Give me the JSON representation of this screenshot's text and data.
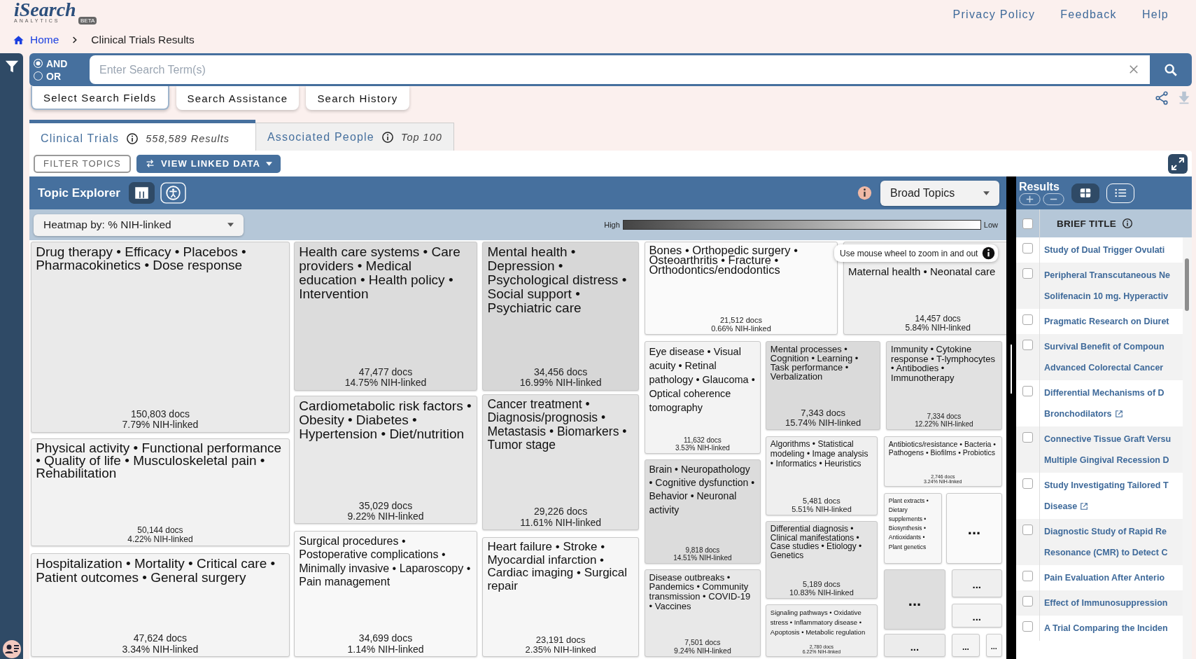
{
  "logo": {
    "name": "iSearch",
    "sub": "ANALYTICS",
    "badge": "BETA"
  },
  "top_links": [
    "Privacy Policy",
    "Feedback",
    "Help"
  ],
  "breadcrumb": {
    "home": "Home",
    "current": "Clinical Trials Results"
  },
  "search": {
    "logic": [
      {
        "label": "AND",
        "selected": true
      },
      {
        "label": "OR",
        "selected": false
      }
    ],
    "placeholder": "Enter Search Term(s)"
  },
  "search_buttons": [
    "Select Search Fields",
    "Search Assistance",
    "Search History"
  ],
  "tabs": [
    {
      "label": "Clinical Trials",
      "count": "558,589 Results",
      "selected": true
    },
    {
      "label": "Associated People",
      "count": "Top 100",
      "selected": false
    }
  ],
  "toolbar": {
    "filter": "FILTER TOPICS",
    "linked": "VIEW LINKED DATA"
  },
  "explorer": {
    "title": "Topic Explorer",
    "topic_level": "Broad Topics",
    "heatmap": "Heatmap by: % NIH-linked",
    "legend_high": "High",
    "legend_low": "Low",
    "tooltip": "Use mouse wheel to zoom in and out"
  },
  "tiles": [
    {
      "kind": "topic",
      "label": "Drug therapy • Efficacy • Placebos • Pharmacokinetics • Dose response",
      "docs": "150,803 docs",
      "nih": "7.79% NIH-linked",
      "color": "#eaeaea"
    },
    {
      "kind": "topic",
      "label": "Physical activity • Functional performance • Quality of life • Musculoskeletal pain • Rehabilitation",
      "docs": "50,144 docs",
      "nih": "4.22% NIH-linked",
      "color": "#f2f2f2"
    },
    {
      "kind": "topic",
      "label": "Hospitalization • Mortality • Critical care • Patient outcomes • General surgery",
      "docs": "47,624 docs",
      "nih": "3.34% NIH-linked",
      "color": "#f4f4f4"
    },
    {
      "kind": "topic",
      "label": "Health care systems • Care providers • Medical education • Health policy • Intervention",
      "docs": "47,477 docs",
      "nih": "14.75% NIH-linked",
      "color": "#dcdcdc"
    },
    {
      "kind": "topic",
      "label": "Cardiometabolic risk factors • Obesity • Diabetes • Hypertension • Diet/nutrition",
      "docs": "35,029 docs",
      "nih": "9.22% NIH-linked",
      "color": "#e8e8e8"
    },
    {
      "kind": "topic",
      "label": "Surgical procedures • Postoperative complications • Minimally invasive • Laparoscopy • Pain management",
      "docs": "34,699 docs",
      "nih": "1.14% NIH-linked",
      "color": "#f8f8f8"
    },
    {
      "kind": "topic",
      "label": "Mental health • Depression • Psychological distress • Social support • Psychiatric care",
      "docs": "34,456 docs",
      "nih": "16.99% NIH-linked",
      "color": "#d7d7d7"
    },
    {
      "kind": "topic",
      "label": "Cancer treatment • Diagnosis/prognosis • Metastasis • Biomarkers • Tumor stage",
      "docs": "29,226 docs",
      "nih": "11.61% NIH-linked",
      "color": "#e3e3e3"
    },
    {
      "kind": "topic",
      "label": "Heart failure • Stroke • Myocardial infarction • Cardiac imaging • Surgical repair",
      "docs": "23,191 docs",
      "nih": "2.35% NIH-linked",
      "color": "#f6f6f6"
    },
    {
      "kind": "topic",
      "label": "Bones • Orthopedic surgery • Osteoarthritis • Fracture • Orthodontics/endodontics",
      "docs": "21,512 docs",
      "nih": "0.66% NIH-linked",
      "color": "#fafafa"
    },
    {
      "kind": "topic",
      "label": "Maternal health • Neonatal care",
      "docs": "14,457 docs",
      "nih": "5.84% NIH-linked",
      "color": "#efefef"
    },
    {
      "kind": "topic",
      "label": "Eye disease • Visual acuity • Retinal pathology • Glaucoma • Optical coherence tomography",
      "docs": "11,632 docs",
      "nih": "3.53% NIH-linked",
      "color": "#f3f3f3"
    },
    {
      "kind": "topic",
      "label": "Brain • Neuropathology • Cognitive dysfunction • Behavior • Neuronal activity",
      "docs": "9,818 docs",
      "nih": "14.51% NIH-linked",
      "color": "#dcdcdc"
    },
    {
      "kind": "topic",
      "label": "Disease outbreaks • Pandemics • Community transmission • COVID-19 • Vaccines",
      "docs": "7,501 docs",
      "nih": "9.24% NIH-linked",
      "color": "#e8e8e8"
    },
    {
      "kind": "topic",
      "label": "Mental processes • Cognition • Learning • Task performance • Verbalization",
      "docs": "7,343 docs",
      "nih": "15.74% NIH-linked",
      "color": "#dadada"
    },
    {
      "kind": "topic",
      "label": "Algorithms • Statistical modeling • Image analysis • Informatics • Heuristics",
      "docs": "5,481 docs",
      "nih": "5.51% NIH-linked",
      "color": "#efefef"
    },
    {
      "kind": "topic",
      "label": "Differential diagnosis • Clinical manifestations • Case studies • Etiology • Genetics",
      "docs": "5,189 docs",
      "nih": "10.83% NIH-linked",
      "color": "#e4e4e4"
    },
    {
      "kind": "topic",
      "label": "Signaling pathways • Oxidative stress • Inflammatory disease • Apoptosis • Metabolic regulation",
      "docs": "2,780 docs",
      "nih": "6.22% NIH-linked",
      "color": "#eeeeee"
    },
    {
      "kind": "topic",
      "label": "Immunity • Cytokine response • T-lymphocytes • Antibodies • Immunotherapy",
      "docs": "7,334 docs",
      "nih": "12.22% NIH-linked",
      "color": "#e1e1e1"
    },
    {
      "kind": "topic",
      "label": "Antibiotics/resistance • Bacteria • Pathogens • Biofilms • Probiotics",
      "docs": "2,746 docs",
      "nih": "3.24% NIH-linked",
      "color": "#f4f4f4"
    },
    {
      "kind": "topic",
      "label": "Plant extracts • Dietary supplements • Biosynthesis • Antioxidants • Plant genetics",
      "color": "#f7f7f7"
    },
    {
      "kind": "more",
      "label": "...",
      "color": "#fafafa"
    },
    {
      "kind": "more",
      "label": "...",
      "color": "#dedede"
    },
    {
      "kind": "more",
      "label": "...",
      "color": "#efefef"
    },
    {
      "kind": "more",
      "label": "...",
      "color": "#f4f4f4"
    },
    {
      "kind": "more",
      "label": "...",
      "color": "#ececec"
    },
    {
      "kind": "more",
      "label": "...",
      "color": "#f4f4f4"
    },
    {
      "kind": "more",
      "label": "...",
      "color": "#f7f7f7"
    }
  ],
  "results": {
    "title": "Results",
    "views": [
      {
        "kind": "grid",
        "selected": true
      },
      {
        "kind": "list",
        "selected": false
      }
    ],
    "column": "BRIEF TITLE",
    "select_all_checked": false,
    "rows": [
      {
        "lines": [
          "Study of Dual Trigger Ovulati"
        ],
        "link_icon": false,
        "checked": false
      },
      {
        "lines": [
          "Peripheral Transcutaneous Ne",
          "Solifenacin 10 mg. Hyperactiv"
        ],
        "link_icon": false,
        "checked": false
      },
      {
        "lines": [
          "Pragmatic Research on Diuret"
        ],
        "link_icon": false,
        "checked": false
      },
      {
        "lines": [
          "Survival Benefit of Compoun",
          "Advanced Colorectal Cancer"
        ],
        "link_icon": false,
        "checked": false
      },
      {
        "lines": [
          "Differential Mechanisms of D",
          "Bronchodilators"
        ],
        "link_icon": true,
        "checked": false
      },
      {
        "lines": [
          "Connective Tissue Graft Versu",
          "Multiple Gingival Recession D"
        ],
        "link_icon": false,
        "checked": false
      },
      {
        "lines": [
          "Study Investigating Tailored T",
          "Disease"
        ],
        "link_icon": true,
        "checked": false
      },
      {
        "lines": [
          "Diagnostic Study of Rapid Re",
          "Resonance (CMR) to Detect C"
        ],
        "link_icon": false,
        "checked": false
      },
      {
        "lines": [
          "Pain Evaluation After Anterio"
        ],
        "link_icon": false,
        "checked": false
      },
      {
        "lines": [
          "Effect of Immunosuppression"
        ],
        "link_icon": false,
        "checked": false
      },
      {
        "lines": [
          "A Trial Comparing the Inciden"
        ],
        "link_icon": false,
        "checked": false
      }
    ]
  }
}
